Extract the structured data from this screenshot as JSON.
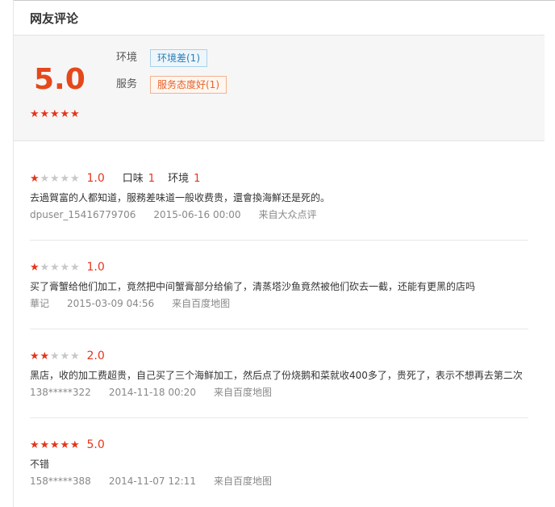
{
  "section_title": "网友评论",
  "summary": {
    "score": "5.0",
    "stars": 5,
    "tags": [
      {
        "label": "环境",
        "tag": "环境差(1)",
        "color": "#2a7fb8"
      },
      {
        "label": "服务",
        "tag": "服务态度好(1)",
        "color": "#e6632a"
      }
    ]
  },
  "reviews": [
    {
      "stars": 1,
      "score": "1.0",
      "sub_ratings": [
        {
          "label": "口味",
          "value": "1"
        },
        {
          "label": "环境",
          "value": "1"
        }
      ],
      "text": "去過賀富的人都知道，服務差味道一般收费贵，還會換海鮮还是死的。",
      "user": "dpuser_15416779706",
      "date": "2015-06-16 00:00",
      "source": "来自大众点评"
    },
    {
      "stars": 1,
      "score": "1.0",
      "sub_ratings": [],
      "text": "买了膏蟹给他们加工，竟然把中间蟹膏部分给偷了，清蒸塔沙鱼竟然被他们砍去一截，还能有更黑的店吗",
      "user": "華记",
      "date": "2015-03-09 04:56",
      "source": "来自百度地图"
    },
    {
      "stars": 2,
      "score": "2.0",
      "sub_ratings": [],
      "text": "黑店，收的加工费超贵，自己买了三个海鲜加工，然后点了份烧鹅和菜就收400多了，贵死了，表示不想再去第二次",
      "user": "138*****322",
      "date": "2014-11-18 00:20",
      "source": "来自百度地图"
    },
    {
      "stars": 5,
      "score": "5.0",
      "sub_ratings": [],
      "text": "不错",
      "user": "158*****388",
      "date": "2014-11-07 12:11",
      "source": "来自百度地图"
    }
  ],
  "colors": {
    "accent": "#e4351b",
    "score": "#e4481b"
  }
}
